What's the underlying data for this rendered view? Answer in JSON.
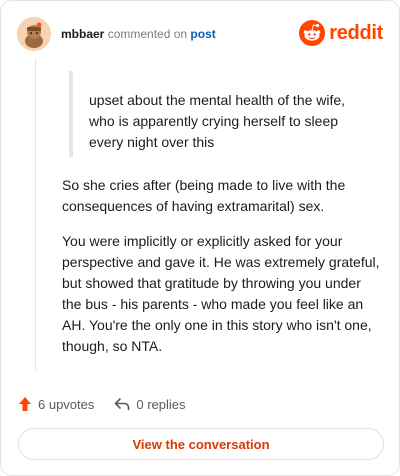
{
  "header": {
    "username": "mbbaer",
    "verb": " commented on ",
    "post_link": "post",
    "brand": "reddit"
  },
  "comment": {
    "quote": "upset about the mental health of the wife, who is apparently crying herself to sleep every night over this",
    "paragraphs": [
      "So she cries after (being made to live with the consequences of having extramarital) sex.",
      "You were implicitly or explicitly asked for your perspective and gave it. He was extremely grateful, but showed that gratitude by throwing you under the bus - his parents - who made you feel like an AH. You're the only one in this story who isn't one, though, so NTA."
    ]
  },
  "footer": {
    "upvotes": "6 upvotes",
    "replies": "0 replies",
    "cta": "View the conversation"
  },
  "colors": {
    "brand": "#ff4500",
    "link": "#0b5fb5",
    "cta": "#d93a00"
  },
  "icons": {
    "avatar": "snoo-avatar",
    "logo": "reddit-snoo-icon",
    "upvote": "upvote-arrow-icon",
    "reply": "reply-arrow-icon"
  }
}
